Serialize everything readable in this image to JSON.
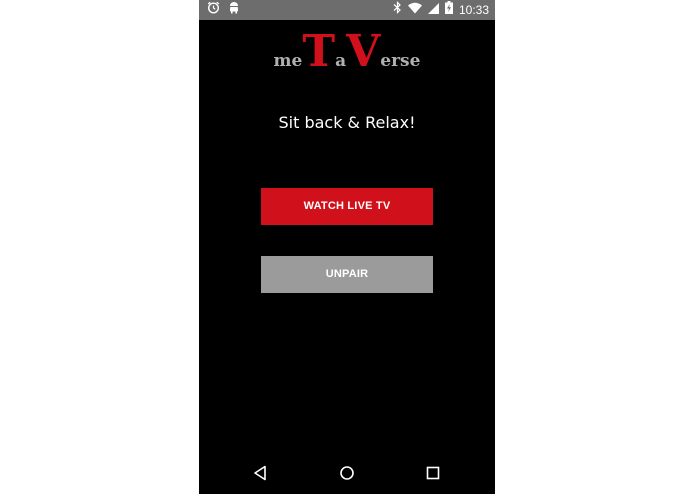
{
  "status_bar": {
    "time": "10:33",
    "left_icons": [
      "alarm-icon",
      "android-debug-icon"
    ],
    "right_icons": [
      "bluetooth-icon",
      "wifi-icon",
      "cell-signal-icon",
      "battery-charging-icon"
    ]
  },
  "logo": {
    "part1": "me",
    "big1": "T",
    "part2": "a",
    "big2": "V",
    "part3": "erse"
  },
  "tagline": "Sit back & Relax!",
  "buttons": {
    "watch_live_tv": "WATCH LIVE TV",
    "unpair": "UNPAIR"
  },
  "nav_bar": {
    "icons": [
      "back-icon",
      "home-icon",
      "recent-apps-icon"
    ]
  },
  "colors": {
    "background": "#000000",
    "accent_red": "#d0101a",
    "button_gray": "#9b9b9b",
    "status_bar": "#6d6d6d"
  }
}
